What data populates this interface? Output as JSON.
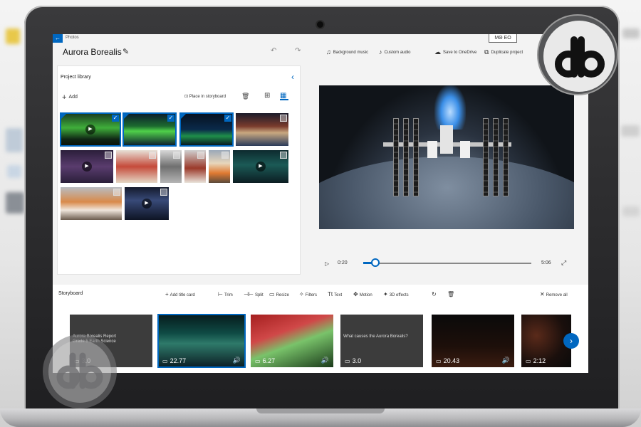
{
  "app": {
    "name": "Photos",
    "project_title": "Aurora Borealis",
    "back_arrow": "←",
    "topbox_label": "ΜΘ ΕΟ"
  },
  "toolbar": {
    "items": [
      {
        "icon": "background-music-icon",
        "glyph": "♫",
        "label": "Background music"
      },
      {
        "icon": "custom-audio-icon",
        "glyph": "♪",
        "label": "Custom audio"
      },
      {
        "icon": "save-onedrive-icon",
        "glyph": "☁",
        "label": "Save to OneDrive"
      },
      {
        "icon": "duplicate-icon",
        "glyph": "⧉",
        "label": "Duplicate project"
      }
    ]
  },
  "library": {
    "title": "Project library",
    "add_label": "Add",
    "place_label": "Place in storyboard",
    "collapse_glyph": "‹",
    "thumbs": [
      {
        "kind": "video",
        "selected": true,
        "bg": "linear-gradient(180deg,#1a3a20 0%,#3fae3a 45%,#0f2514 80%,#0a1208 100%)"
      },
      {
        "kind": "image",
        "selected": true,
        "bg": "linear-gradient(180deg,#0b1a2d 0%,#1d6b2f 40%,#4fd04a 55%,#0b1a2d 100%)"
      },
      {
        "kind": "image",
        "selected": true,
        "bg": "linear-gradient(180deg,#06101f 0%,#0a2a4a 50%,#1f8f4a 70%,#06101f 100%)"
      },
      {
        "kind": "image",
        "selected": false,
        "bg": "linear-gradient(180deg,#1b1b2a 0%,#7a3b2d 40%,#c9a880 60%,#2b3b5a 100%)"
      },
      {
        "kind": "video",
        "selected": false,
        "bg": "linear-gradient(180deg,#2b1e3a 0%,#5a3c6e 50%,#2a1f3a 100%)"
      },
      {
        "kind": "image",
        "selected": false,
        "bg": "linear-gradient(180deg,#e7e0d6 0%,#c54a3a 50%,#e4d7c5 100%)"
      },
      {
        "kind": "image",
        "selected": false,
        "bg": "linear-gradient(180deg,#d8d8d8 0%,#6f6f6f 50%,#b5b5b5 100%)"
      },
      {
        "kind": "image",
        "selected": false,
        "bg": "linear-gradient(180deg,#cfcfcf 0%,#9b3a2a 55%,#e9e3da 100%)"
      },
      {
        "kind": "image",
        "selected": false,
        "bg": "linear-gradient(180deg,#9aa8b8 0%,#e7d6bb 40%,#e07a32 70%,#5b4a3a 100%)"
      },
      {
        "kind": "video",
        "selected": false,
        "bg": "linear-gradient(180deg,#0d2a2e 0%,#1b5a56 45%,#0c1d22 100%)"
      },
      {
        "kind": "image",
        "selected": false,
        "bg": "linear-gradient(180deg,#b8bcc2 0%,#d98a4a 45%,#f0e6dc 70%,#6c5c4e 100%)"
      },
      {
        "kind": "video",
        "selected": false,
        "bg": "linear-gradient(180deg,#141a2c 0%,#384a78 40%,#0e1424 100%)"
      }
    ]
  },
  "player": {
    "play_glyph": "▷",
    "current_time": "0:20",
    "total_time": "5:06",
    "progress_fraction": 0.07,
    "fullscreen_glyph": "⤢"
  },
  "storyboard": {
    "title": "Storyboard",
    "tools": [
      {
        "glyph": "+",
        "label": "Add title card"
      },
      {
        "glyph": "⊢",
        "label": "Trim"
      },
      {
        "glyph": "⊣⊢",
        "label": "Split"
      },
      {
        "glyph": "▭",
        "label": "Resize"
      },
      {
        "glyph": "✧",
        "label": "Filters"
      },
      {
        "glyph": "Tt",
        "label": "Text"
      },
      {
        "glyph": "✥",
        "label": "Motion"
      },
      {
        "glyph": "✦",
        "label": "3D effects"
      },
      {
        "glyph": "↻",
        "label": ""
      },
      {
        "glyph": "🗑",
        "label": ""
      }
    ],
    "remove_all_label": "Remove all",
    "clips": [
      {
        "text": "Aurora Borealis Report\nGrade 5 Earth Science",
        "duration": "3.0",
        "audio": false,
        "selected": false,
        "bg": "#3c3c3c"
      },
      {
        "text": "",
        "duration": "22.77",
        "audio": true,
        "selected": true,
        "bg": "linear-gradient(180deg,#061a1c 0%,#0f4a44 35%,#2e7a6a 55%,#0c1e24 100%)"
      },
      {
        "text": "",
        "duration": "6.27",
        "audio": true,
        "selected": false,
        "bg": "linear-gradient(160deg,#a51f1f 0%,#d04848 35%,#79c36a 55%,#1a3a1a 100%)"
      },
      {
        "text": "What causes the Aurora Borealis?",
        "duration": "3.0",
        "audio": false,
        "selected": false,
        "bg": "#3c3c3c"
      },
      {
        "text": "",
        "duration": "20.43",
        "audio": true,
        "selected": false,
        "bg": "linear-gradient(180deg,#0a0a0a 0%,#1d0f0a 60%,#3a1c10 100%)"
      },
      {
        "text": "",
        "duration": "2:12",
        "audio": false,
        "selected": false,
        "bg": "radial-gradient(circle at 30% 40%,#5a2a1a 0%,#1a0f0c 60%,#0a0a0a 100%)"
      }
    ],
    "next_glyph": "›"
  },
  "watermark": {
    "logo_text": "db",
    "logo_color": "#111111",
    "logo_faded_color": "#8a8a8c"
  },
  "colors": {
    "accent": "#0067c0"
  }
}
